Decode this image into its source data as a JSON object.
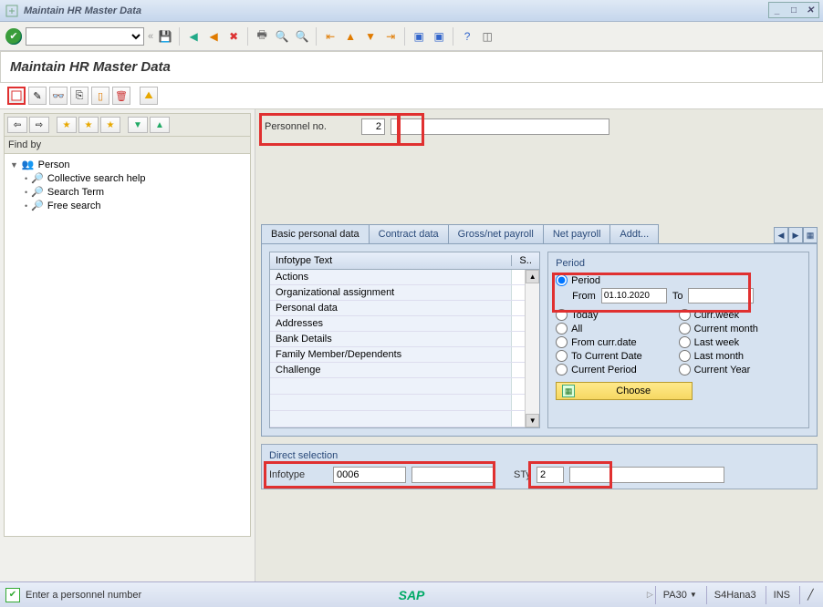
{
  "window_title": "Maintain HR Master Data",
  "page_title": "Maintain HR Master Data",
  "find_by_label": "Find by",
  "tree": {
    "root": "Person",
    "children": [
      "Collective search help",
      "Search Term",
      "Free search"
    ]
  },
  "personnel": {
    "label": "Personnel no.",
    "value": "2"
  },
  "tabs": [
    "Basic personal data",
    "Contract data",
    "Gross/net payroll",
    "Net payroll",
    "Addt..."
  ],
  "active_tab": 0,
  "infotype_table": {
    "header_text": "Infotype Text",
    "header_s": "S..",
    "rows": [
      "Actions",
      "Organizational assignment",
      "Personal data",
      "Addresses",
      "Bank Details",
      "Family Member/Dependents",
      "Challenge"
    ]
  },
  "period": {
    "title": "Period",
    "radios_left": [
      "Period",
      "Today",
      "All",
      "From curr.date",
      "To Current Date",
      "Current Period"
    ],
    "radios_right": [
      "Curr.week",
      "Current month",
      "Last week",
      "Last month",
      "Current Year"
    ],
    "selected": "Period",
    "from_label": "From",
    "from_value": "01.10.2020",
    "to_label": "To",
    "to_value": "",
    "choose_label": "Choose"
  },
  "direct_selection": {
    "title": "Direct selection",
    "infotype_label": "Infotype",
    "infotype_value": "0006",
    "sty_label": "STy",
    "sty_value": "2"
  },
  "status": {
    "message": "Enter a personnel number",
    "tcode": "PA30",
    "system": "S4Hana3",
    "mode": "INS"
  }
}
